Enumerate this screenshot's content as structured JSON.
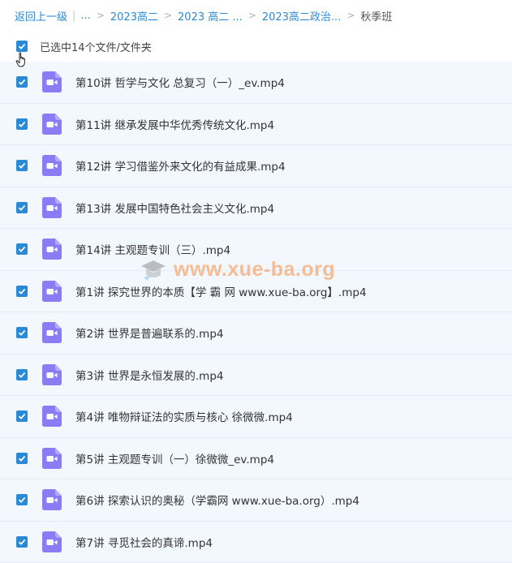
{
  "breadcrumb": {
    "back": "返回上一级",
    "pipe": "|",
    "ellipsis": "...",
    "sep": ">",
    "items": [
      "2023高二",
      "2023 高二 ...",
      "2023高二政治..."
    ],
    "current": "秋季班"
  },
  "selection": {
    "label": "已选中14个文件/文件夹",
    "checked": true
  },
  "files": [
    {
      "name": "第10讲 哲学与文化 总复习（一）_ev.mp4"
    },
    {
      "name": "第11讲 继承发展中华优秀传统文化.mp4"
    },
    {
      "name": "第12讲 学习借鉴外来文化的有益成果.mp4"
    },
    {
      "name": "第13讲 发展中国特色社会主义文化.mp4"
    },
    {
      "name": "第14讲 主观题专训（三）.mp4"
    },
    {
      "name": "第1讲 探究世界的本质【学 霸 网 www.xue-ba.org】.mp4"
    },
    {
      "name": "第2讲 世界是普遍联系的.mp4"
    },
    {
      "name": "第3讲 世界是永恒发展的.mp4"
    },
    {
      "name": "第4讲 唯物辩证法的实质与核心 徐微微.mp4"
    },
    {
      "name": "第5讲 主观题专训（一）徐微微_ev.mp4"
    },
    {
      "name": "第6讲 探索认识的奥秘（学霸网 www.xue-ba.org）.mp4"
    },
    {
      "name": "第7讲 寻觅社会的真谛.mp4"
    }
  ],
  "watermark": {
    "text": "www.xue-ba.org"
  },
  "colors": {
    "accent": "#2b8ad6",
    "video_icon": "#8b7cf5",
    "row_bg": "#f3f8fe"
  },
  "icons": {
    "checkbox": "checkmark-icon",
    "file": "video-file-icon",
    "cursor": "hand-pointer-icon",
    "watermark_logo": "graduation-cap-icon"
  }
}
